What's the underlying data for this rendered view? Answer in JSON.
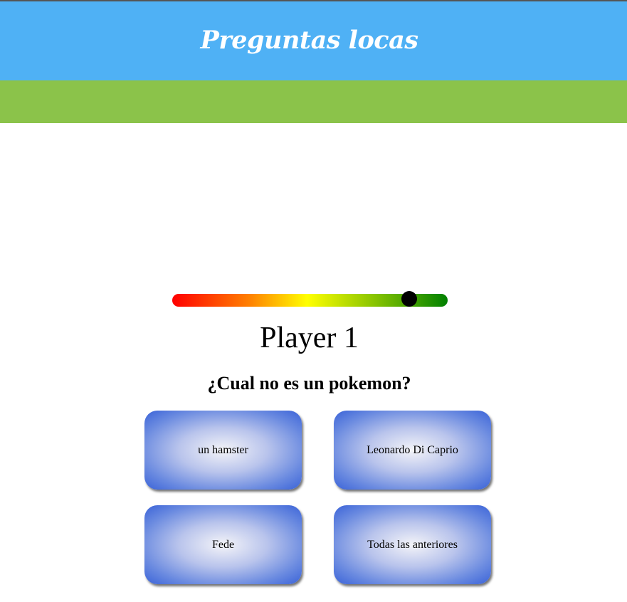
{
  "header": {
    "title": "Preguntas locas",
    "colors": {
      "header_bg": "#4fb1f5",
      "band_bg": "#8bc34a"
    }
  },
  "timer": {
    "remaining_fraction": 0.86
  },
  "game": {
    "player_label": "Player 1",
    "question": "¿Cual no es un pokemon?",
    "answers": [
      "un hamster",
      "Leonardo Di Caprio",
      "Fede",
      "Todas las anteriores"
    ]
  }
}
